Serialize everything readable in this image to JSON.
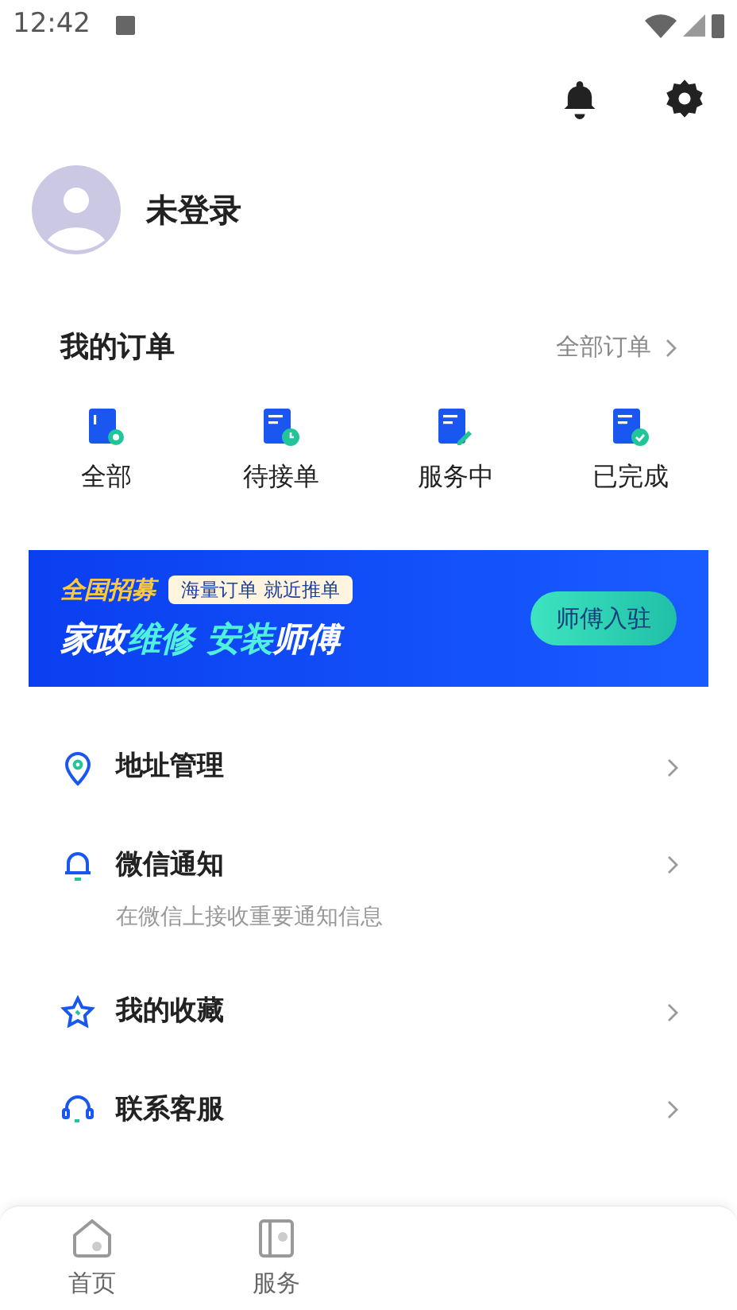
{
  "status_bar": {
    "time": "12:42"
  },
  "profile": {
    "name": "未登录"
  },
  "orders": {
    "title": "我的订单",
    "all_link": "全部订单",
    "items": [
      {
        "kind": "all",
        "label": "全部"
      },
      {
        "kind": "pending",
        "label": "待接单"
      },
      {
        "kind": "in_service",
        "label": "服务中"
      },
      {
        "kind": "done",
        "label": "已完成"
      }
    ]
  },
  "banner": {
    "tag": "全国招募",
    "subtitle": "海量订单 就近推单",
    "headline": [
      [
        {
          "text": "家政",
          "highlight": false
        },
        {
          "text": "维修",
          "highlight": true
        }
      ],
      [
        {
          "text": "安装",
          "highlight": true
        },
        {
          "text": "师傅",
          "highlight": false
        }
      ]
    ],
    "button": "师傅入驻"
  },
  "menu": [
    {
      "kind": "address",
      "label": "地址管理"
    },
    {
      "kind": "notify",
      "label": "微信通知",
      "description": "在微信上接收重要通知信息"
    },
    {
      "kind": "favorite",
      "label": "我的收藏"
    },
    {
      "kind": "service",
      "label": "联系客服"
    }
  ],
  "tab_bar": [
    {
      "kind": "home",
      "label": "首页",
      "selected": false
    },
    {
      "kind": "service",
      "label": "服务",
      "selected": false
    }
  ]
}
